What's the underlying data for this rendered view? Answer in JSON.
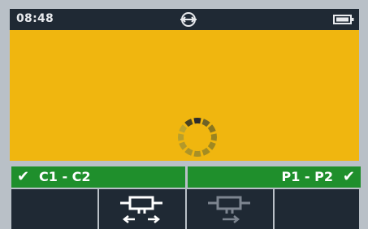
{
  "status": {
    "time": "08:48",
    "center_icon": "probe-link-icon",
    "battery_icon": "battery-icon"
  },
  "main": {
    "state_icon": "loading-spinner-icon",
    "background_color": "#f0b60f"
  },
  "connections": {
    "left_label": "C1 - C2",
    "left_check": "✔",
    "right_label": "P1 - P2",
    "right_check": "✔",
    "ok_color": "#1f8f2c"
  },
  "softkeys": [
    {
      "icon": ""
    },
    {
      "icon": "bidirectional-test-icon",
      "active": true
    },
    {
      "icon": "unidirectional-test-icon",
      "active": false
    },
    {
      "icon": ""
    }
  ]
}
